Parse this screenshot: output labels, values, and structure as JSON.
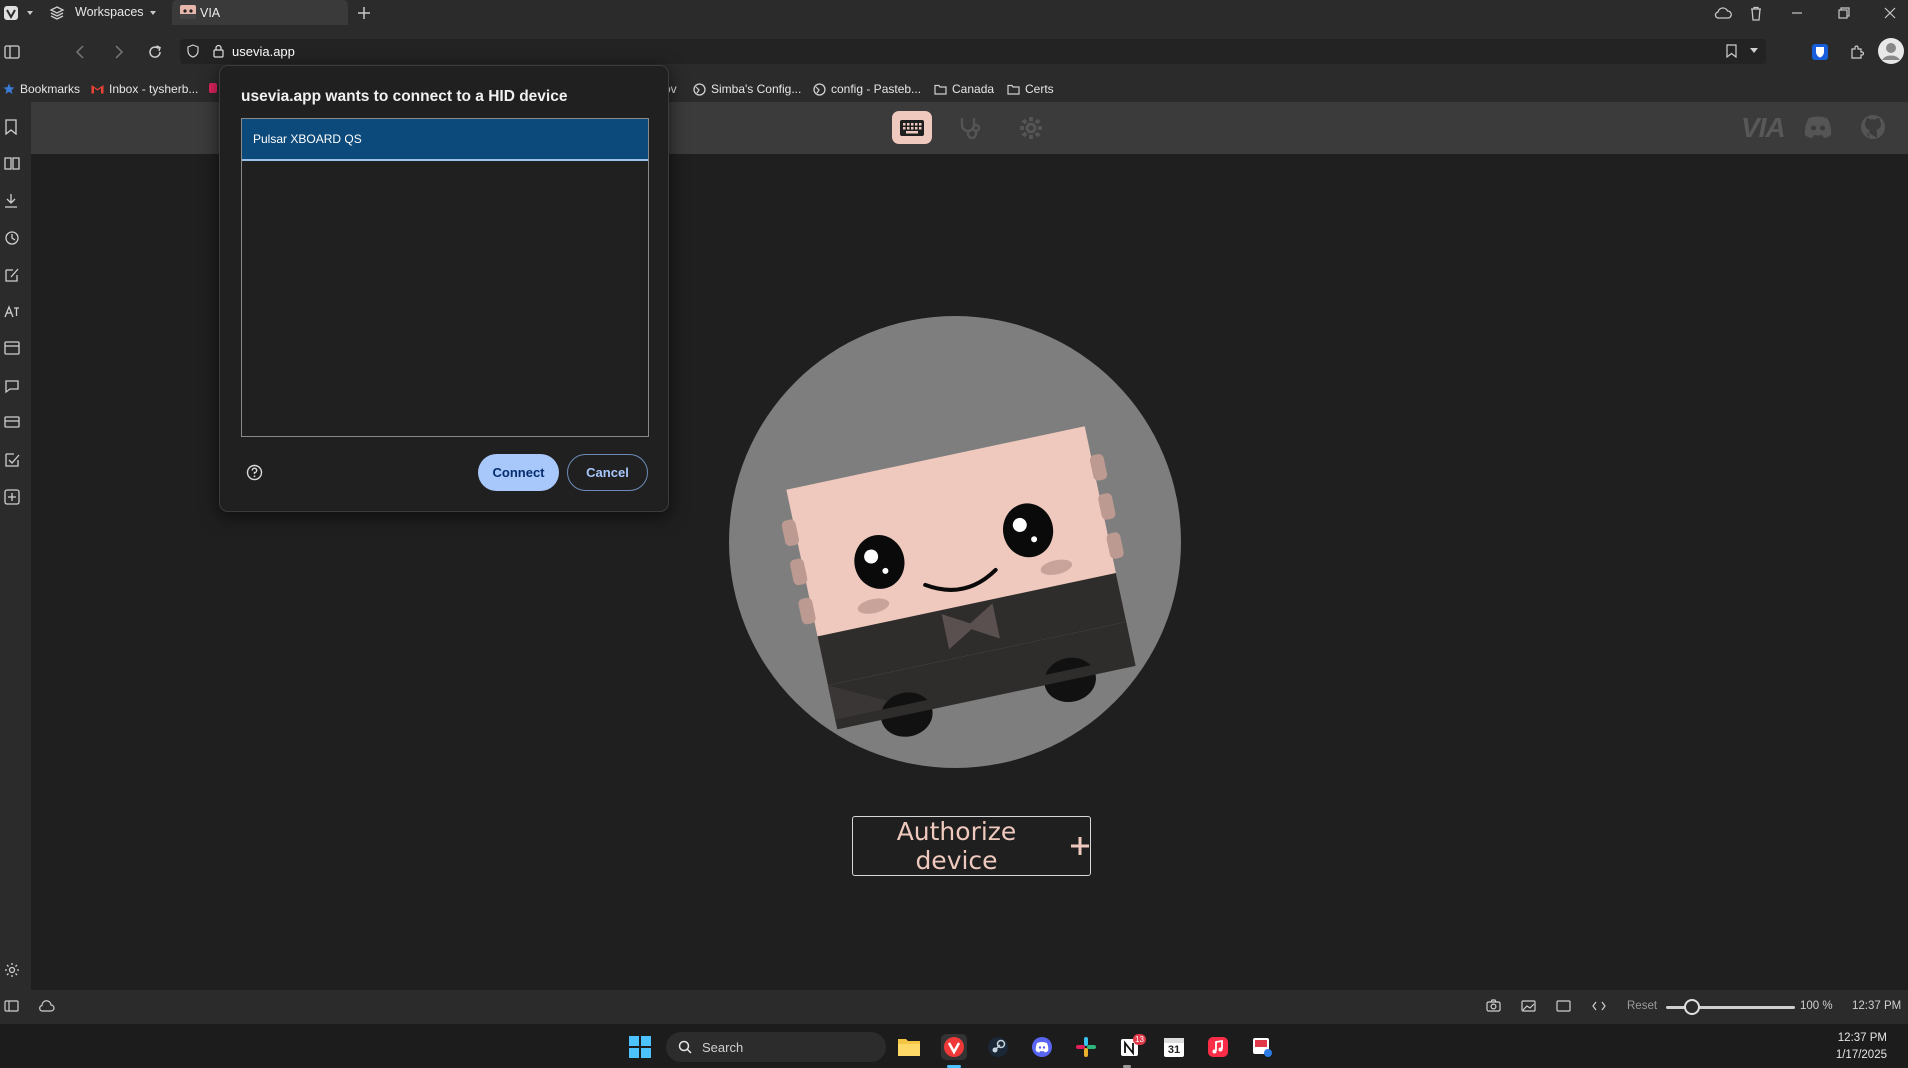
{
  "browser": {
    "workspaces_label": "Workspaces",
    "active_tab_title": "VIA",
    "url": "usevia.app"
  },
  "bookmarks": [
    "Bookmarks",
    "Inbox - tysherb...",
    "ov",
    "Simba's Config...",
    "config - Pasteb...",
    "Canada",
    "Certs"
  ],
  "dialog": {
    "title": "usevia.app wants to connect to a HID device",
    "devices": [
      "Pulsar XBOARD QS"
    ],
    "selected_device": "Pulsar XBOARD QS",
    "connect_label": "Connect",
    "cancel_label": "Cancel"
  },
  "via": {
    "logo_text": "VIA",
    "authorize_label": "Authorize device",
    "authorize_icon": "plus-icon"
  },
  "statusbar": {
    "reset_label": "Reset",
    "zoom_level": "100 %",
    "zoom_fraction": 0.2,
    "time": "12:37 PM"
  },
  "taskbar": {
    "search_placeholder": "Search",
    "notion_badge": "13",
    "calendar_day": "31",
    "clock_time": "12:37 PM",
    "clock_date": "1/17/2025"
  },
  "colors": {
    "accent_pink": "#efc9bd",
    "dialog_button": "#a8c7fa",
    "selection_blue": "#0b4a7a"
  }
}
